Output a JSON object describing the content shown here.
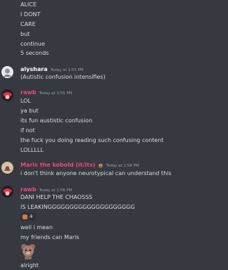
{
  "top_lines": [
    "ALICE",
    "I DONT",
    "CARE",
    "but",
    "continue",
    "5 seconds"
  ],
  "messages": [
    {
      "author": "alyshara",
      "timestamp": "Today at 1:55 PM",
      "lines": [
        "(Autistic confusion intensifies)"
      ]
    },
    {
      "author": "rawb",
      "timestamp": "Today at 1:55 PM",
      "lines": [
        "LOL",
        "ya but",
        "its fun austistic confusion",
        "if not",
        "the fuck you doing reading such confusing content",
        "LOLLLLL"
      ]
    },
    {
      "author": "Maris the kobold (it/its)",
      "timestamp": "Today at 1:56 PM",
      "lines": [
        "i don't think anyone neurotypical can understand this"
      ]
    },
    {
      "author": "rawb",
      "timestamp": "Today at 1:56 PM",
      "lines": [
        "DANI HELP THE CHAOSSS",
        "IS LEAKINGGGGGGGGGGGGGGGGGGGG"
      ],
      "reaction_count": "4",
      "lines_after_reaction": [
        "well i mean",
        "my friends can Maris"
      ],
      "last_line": "alright"
    }
  ],
  "colors": {
    "background": "#36393f",
    "text": "#dcddde",
    "timestamp": "#9aa0a6",
    "pink_author": "#f04775",
    "reaction_bg": "#2f3136"
  }
}
